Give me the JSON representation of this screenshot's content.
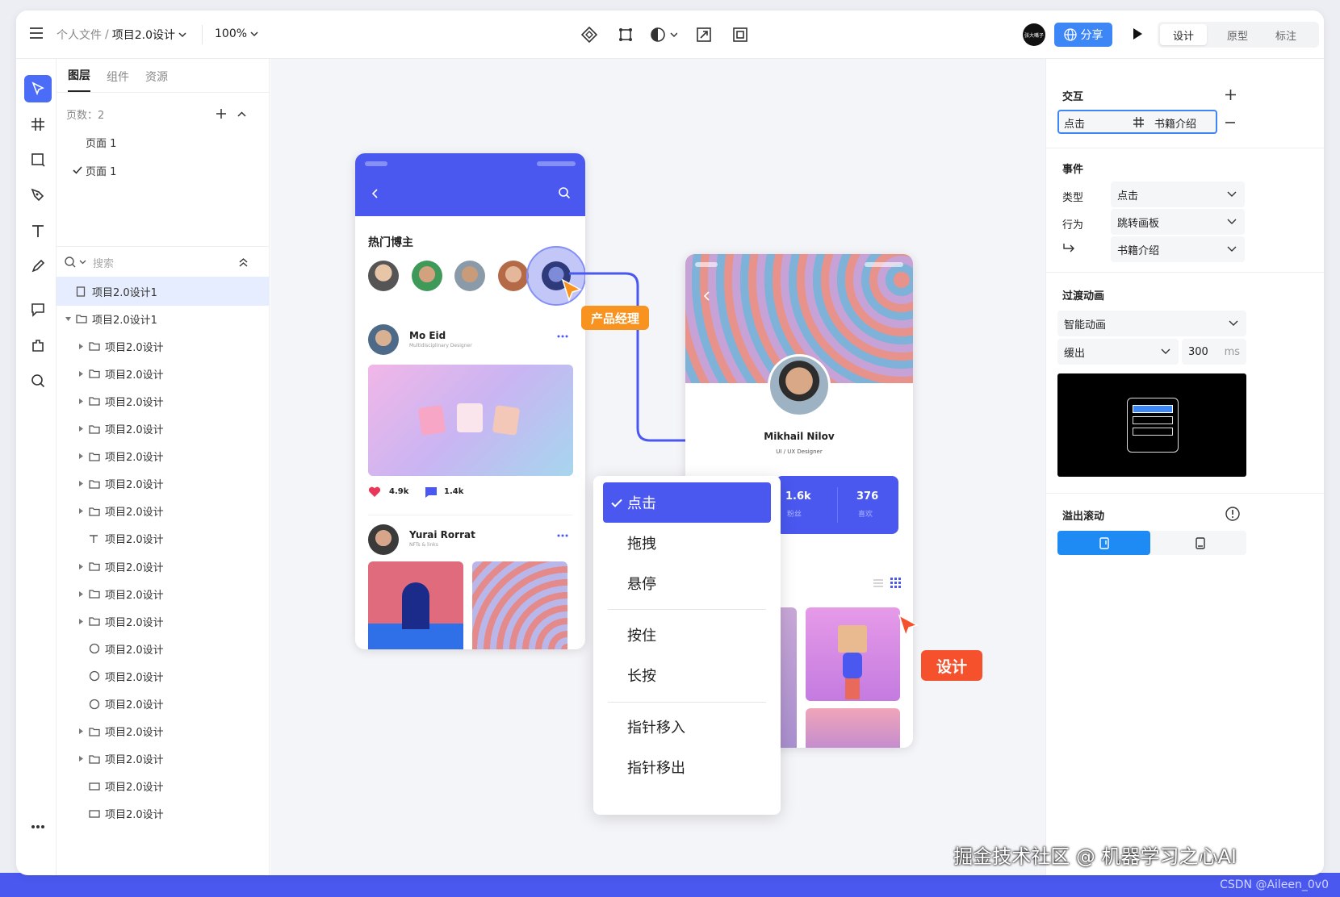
{
  "topbar": {
    "breadcrumb_parent": "个人文件",
    "breadcrumb_sep": "/",
    "project_name": "项目2.0设计",
    "zoom": "100%",
    "user_avatar_text": "张大嘴子",
    "share_label": "分享",
    "mode_tabs": [
      "设计",
      "原型",
      "标注"
    ],
    "active_mode": "设计"
  },
  "layers": {
    "tabs": [
      "图层",
      "组件",
      "资源"
    ],
    "page_count_label": "页数：2",
    "pages": [
      {
        "name": "页面 1",
        "checked": false
      },
      {
        "name": "页面 1",
        "checked": true
      }
    ],
    "search_placeholder": "搜索",
    "items": [
      {
        "name": "项目2.0设计1",
        "icon": "frame-icon",
        "indent": 0,
        "arrow": false,
        "selected": true
      },
      {
        "name": "项目2.0设计1",
        "icon": "folder-icon",
        "indent": 0,
        "arrow": "down",
        "selected": false
      },
      {
        "name": "项目2.0设计",
        "icon": "folder-icon",
        "indent": 1,
        "arrow": "right"
      },
      {
        "name": "项目2.0设计",
        "icon": "folder-icon",
        "indent": 1,
        "arrow": "right"
      },
      {
        "name": "项目2.0设计",
        "icon": "folder-icon",
        "indent": 1,
        "arrow": "right"
      },
      {
        "name": "项目2.0设计",
        "icon": "folder-icon",
        "indent": 1,
        "arrow": "right"
      },
      {
        "name": "项目2.0设计",
        "icon": "folder-icon",
        "indent": 1,
        "arrow": "right"
      },
      {
        "name": "项目2.0设计",
        "icon": "folder-icon",
        "indent": 1,
        "arrow": "right"
      },
      {
        "name": "项目2.0设计",
        "icon": "folder-icon",
        "indent": 1,
        "arrow": "right"
      },
      {
        "name": "项目2.0设计",
        "icon": "text-icon",
        "indent": 1,
        "arrow": false
      },
      {
        "name": "项目2.0设计",
        "icon": "folder-icon",
        "indent": 1,
        "arrow": "right"
      },
      {
        "name": "项目2.0设计",
        "icon": "folder-icon",
        "indent": 1,
        "arrow": "right"
      },
      {
        "name": "项目2.0设计",
        "icon": "folder-icon",
        "indent": 1,
        "arrow": "right"
      },
      {
        "name": "项目2.0设计",
        "icon": "circle-icon",
        "indent": 1,
        "arrow": false
      },
      {
        "name": "项目2.0设计",
        "icon": "circle-icon",
        "indent": 1,
        "arrow": false
      },
      {
        "name": "项目2.0设计",
        "icon": "circle-icon",
        "indent": 1,
        "arrow": false
      },
      {
        "name": "项目2.0设计",
        "icon": "folder-icon",
        "indent": 1,
        "arrow": "right"
      },
      {
        "name": "项目2.0设计",
        "icon": "folder-icon",
        "indent": 1,
        "arrow": "right"
      },
      {
        "name": "项目2.0设计",
        "icon": "rect-icon",
        "indent": 1,
        "arrow": false
      },
      {
        "name": "项目2.0设计",
        "icon": "rect-icon",
        "indent": 1,
        "arrow": false
      }
    ]
  },
  "canvas": {
    "phone1": {
      "section_title": "热门博主",
      "post1": {
        "name": "Mo Eid",
        "subtitle": "Multidisciplinary Designer",
        "likes": "4.9k",
        "comments": "1.4k"
      },
      "post2": {
        "name": "Yurai Rorrat",
        "subtitle": "NFTs & links"
      }
    },
    "phone2": {
      "name": "Mikhail Nilov",
      "subtitle": "UI / UX Designer",
      "stat1_value": "1.6k",
      "stat1_label": "粉丝",
      "stat2_value": "376",
      "stat2_label": "喜欢"
    },
    "tag_pm": "产品经理",
    "tag_design": "设计",
    "trigger_menu": {
      "items": [
        "点击",
        "拖拽",
        "悬停",
        "按住",
        "长按",
        "指针移入",
        "指针移出"
      ],
      "selected": "点击"
    }
  },
  "inspector": {
    "interaction_title": "交互",
    "interaction_trigger": "点击",
    "interaction_target": "书籍介绍",
    "event_title": "事件",
    "type_label": "类型",
    "type_value": "点击",
    "action_label": "行为",
    "action_value": "跳转画板",
    "target_value": "书籍介绍",
    "transition_title": "过渡动画",
    "transition_value": "智能动画",
    "easing_value": "缓出",
    "duration_value": "300",
    "duration_unit": "ms",
    "overflow_title": "溢出滚动"
  },
  "watermark": "掘金技术社区 @ 机器学习之心AI",
  "csdn": "CSDN @Aileen_0v0",
  "colors": {
    "accent": "#4a58f0",
    "share": "#3d86f5",
    "orange": "#f7931e",
    "red": "#f4512c"
  }
}
